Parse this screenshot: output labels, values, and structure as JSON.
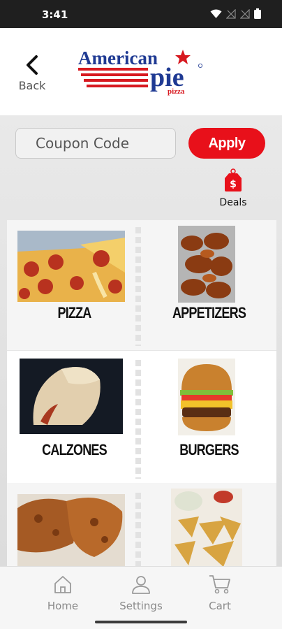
{
  "status_bar": {
    "time": "3:41",
    "icons": [
      "wifi-icon",
      "signal-off-icon",
      "signal-off-icon",
      "battery-icon"
    ]
  },
  "header": {
    "back_label": "Back",
    "logo": {
      "line1": "American",
      "line2": "pie",
      "line3": "pizza"
    }
  },
  "coupon": {
    "placeholder": "Coupon Code",
    "value": "",
    "apply_label": "Apply"
  },
  "deals": {
    "label": "Deals",
    "icon": "price-tag-icon"
  },
  "categories": [
    {
      "label": "PIZZA",
      "image": "pizza-image"
    },
    {
      "label": "APPETIZERS",
      "image": "wings-image"
    },
    {
      "label": "CALZONES",
      "image": "calzone-image"
    },
    {
      "label": "BURGERS",
      "image": "burger-image"
    },
    {
      "label": "",
      "image": "fried-chicken-image"
    },
    {
      "label": "",
      "image": "potato-wedges-image"
    }
  ],
  "bottom_nav": {
    "items": [
      {
        "label": "Home",
        "icon": "home-icon"
      },
      {
        "label": "Settings",
        "icon": "user-icon"
      },
      {
        "label": "Cart",
        "icon": "cart-icon"
      }
    ]
  },
  "colors": {
    "accent": "#e8101a",
    "brand_blue": "#1f3a93",
    "brand_red": "#d71920"
  }
}
